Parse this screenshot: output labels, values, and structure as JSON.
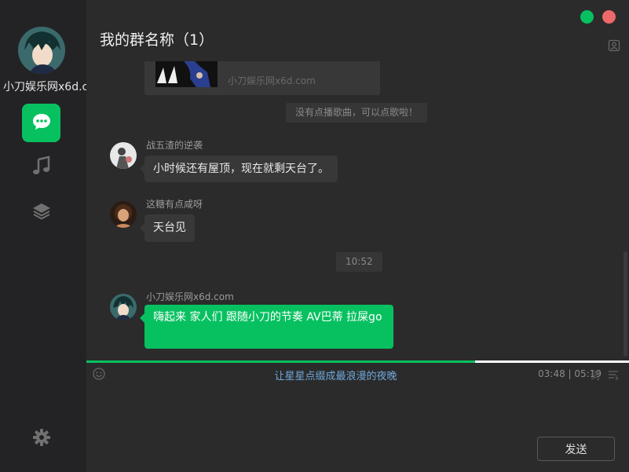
{
  "sidebar": {
    "user_name": "小刀娱乐网x6d.c",
    "nav": [
      "chat",
      "music",
      "layers"
    ],
    "settings_icon": "gear-icon"
  },
  "header": {
    "title": "我的群名称（1）"
  },
  "window_controls": {
    "colors": [
      "#07c160",
      "#ee6a6a"
    ]
  },
  "chat": {
    "media_card": {
      "text": "小刀娱乐网x6d.com"
    },
    "system_notice": "没有点播歌曲，可以点歌啦！",
    "messages": [
      {
        "name": "战五渣的逆袭",
        "text": "小时候还有屋顶，现在就剩天台了。"
      },
      {
        "name": "这糖有点咸呀",
        "text": "天台见"
      }
    ],
    "timestamp": "10:52",
    "my_message": {
      "name": "小刀娱乐网x6d.com",
      "text": "嗨起来  家人们  跟随小刀的节奏  AV巴蒂  拉屎go"
    }
  },
  "player": {
    "lyric": "让星星点缀成最浪漫的夜晚",
    "time": "03:48 | 05:19",
    "progress": 0.716,
    "lyrics_label": "词"
  },
  "composer": {
    "send_label": "发送"
  },
  "colors": {
    "accent": "#07c160",
    "close": "#ee6a6a",
    "lyric": "#6fa8dc"
  }
}
